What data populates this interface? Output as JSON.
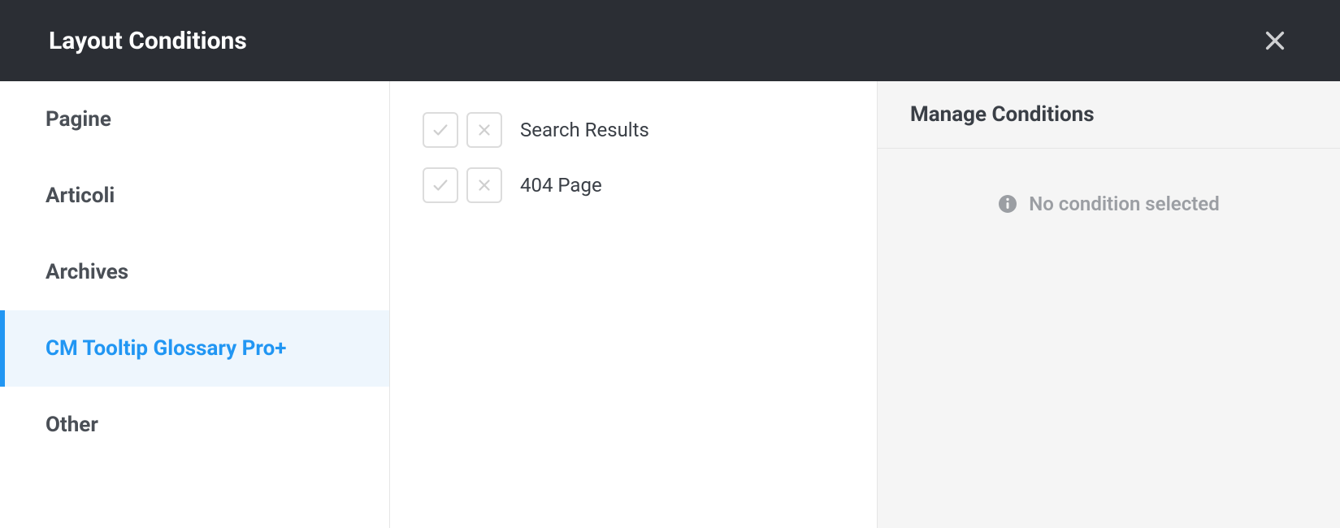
{
  "header": {
    "title": "Layout Conditions"
  },
  "sidebar": {
    "items": [
      {
        "label": "Pagine",
        "active": false
      },
      {
        "label": "Articoli",
        "active": false
      },
      {
        "label": "Archives",
        "active": false
      },
      {
        "label": "CM Tooltip Glossary Pro+",
        "active": true
      },
      {
        "label": "Other",
        "active": false
      }
    ]
  },
  "main": {
    "conditions": [
      {
        "label": "Search Results"
      },
      {
        "label": "404 Page"
      }
    ]
  },
  "rightPanel": {
    "title": "Manage Conditions",
    "emptyMessage": "No condition selected"
  }
}
